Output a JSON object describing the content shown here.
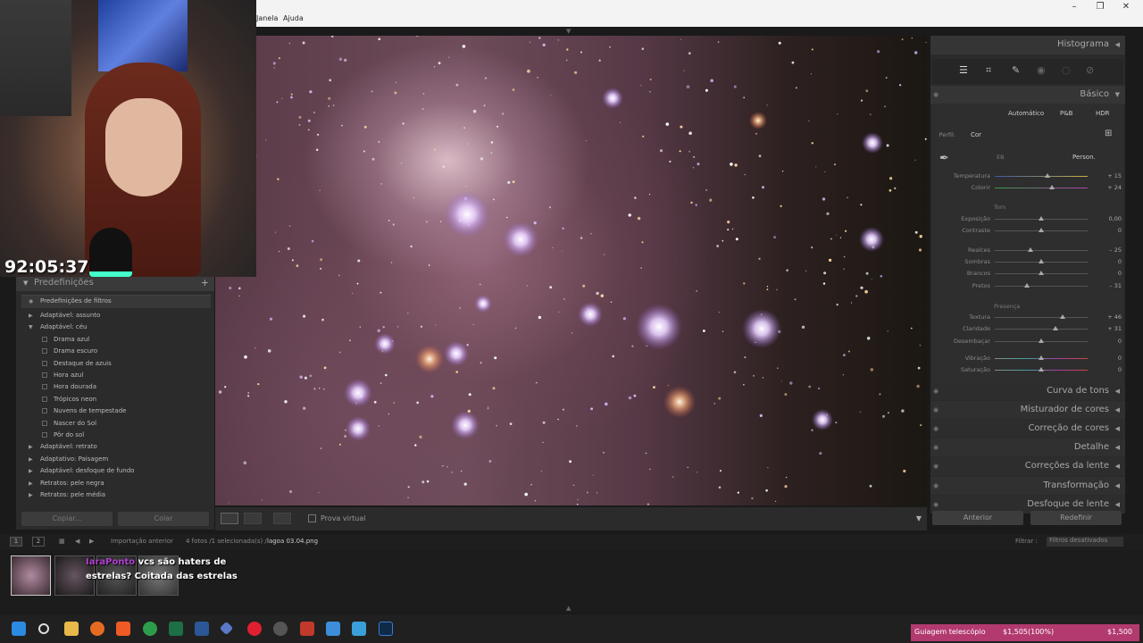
{
  "menu": {
    "items": [
      "Janela",
      "Ajuda"
    ]
  },
  "window": {
    "minimize": "–",
    "restore": "❐",
    "close": "✕"
  },
  "stream": {
    "timer": "92:05:37"
  },
  "presets": {
    "panel_title": "Predefinições",
    "add": "+",
    "items": [
      {
        "label": "Predefinições de filtros",
        "type": "top"
      },
      {
        "label": "Adaptável: assunto",
        "type": "group",
        "expanded": false
      },
      {
        "label": "Adaptável: céu",
        "type": "group",
        "expanded": true
      },
      {
        "label": "Drama azul",
        "type": "preset"
      },
      {
        "label": "Drama escuro",
        "type": "preset"
      },
      {
        "label": "Destaque de azuis",
        "type": "preset"
      },
      {
        "label": "Hora azul",
        "type": "preset"
      },
      {
        "label": "Hora dourada",
        "type": "preset"
      },
      {
        "label": "Trópicos neon",
        "type": "preset"
      },
      {
        "label": "Nuvens de tempestade",
        "type": "preset"
      },
      {
        "label": "Nascer do Sol",
        "type": "preset"
      },
      {
        "label": "Pôr do sol",
        "type": "preset"
      },
      {
        "label": "Adaptável: retrato",
        "type": "group",
        "expanded": false
      },
      {
        "label": "Adaptativo: Paisagem",
        "type": "group",
        "expanded": false
      },
      {
        "label": "Adaptável: desfoque de fundo",
        "type": "group",
        "expanded": false
      },
      {
        "label": "Retratos: pele negra",
        "type": "group",
        "expanded": false
      },
      {
        "label": "Retratos: pele média",
        "type": "group",
        "expanded": false
      }
    ],
    "copy_label": "Copiar...",
    "paste_label": "Colar"
  },
  "toolbar": {
    "soft_proof_label": "Prova virtual"
  },
  "develop": {
    "histogram_label": "Histograma",
    "basic_label": "Básico",
    "treatment": {
      "auto": "Automático",
      "bw": "P&B",
      "hdr": "HDR"
    },
    "profile_label": "Perfil:",
    "profile_value": "Cor",
    "wb_label": "EB",
    "wb_value": "Person.",
    "tone_label": "Tom",
    "presence_label": "Presença",
    "sliders": [
      {
        "label": "Temperatura",
        "value": "+ 15",
        "pos": 0.57,
        "track": "temp"
      },
      {
        "label": "Colorir",
        "value": "+ 24",
        "pos": 0.62,
        "track": "tint"
      },
      {
        "label": "Exposição",
        "value": "0,00",
        "pos": 0.5,
        "track": "plain"
      },
      {
        "label": "Contraste",
        "value": "0",
        "pos": 0.5,
        "track": "plain"
      },
      {
        "label": "Realces",
        "value": "– 25",
        "pos": 0.38,
        "track": "plain"
      },
      {
        "label": "Sombras",
        "value": "0",
        "pos": 0.5,
        "track": "plain"
      },
      {
        "label": "Brancos",
        "value": "0",
        "pos": 0.5,
        "track": "plain"
      },
      {
        "label": "Pretos",
        "value": "– 31",
        "pos": 0.35,
        "track": "plain"
      },
      {
        "label": "Textura",
        "value": "+ 46",
        "pos": 0.73,
        "track": "plain"
      },
      {
        "label": "Claridade",
        "value": "+ 31",
        "pos": 0.65,
        "track": "plain"
      },
      {
        "label": "Desembaçar",
        "value": "0",
        "pos": 0.5,
        "track": "plain"
      },
      {
        "label": "Vibração",
        "value": "0",
        "pos": 0.5,
        "track": "color"
      },
      {
        "label": "Saturação",
        "value": "0",
        "pos": 0.5,
        "track": "color"
      }
    ],
    "panels": [
      "Curva de tons",
      "Misturador de cores",
      "Correção de cores",
      "Detalhe",
      "Correções da lente",
      "Transformação",
      "Desfoque de lente"
    ],
    "previous_label": "Anterior",
    "reset_label": "Redefinir"
  },
  "filmstrip": {
    "page1": "1",
    "page2": "2",
    "source": "Importação anterior",
    "count": "4 fotos /1 selecionada(s) /",
    "filename": "lagoa 03.04.png",
    "filter_label": "Filtrar :",
    "filter_value": "Filtros desativados"
  },
  "chat": {
    "user": "IaraPonto",
    "message": "vcs são haters de estrelas? Coitada das estrelas"
  },
  "ticker": {
    "label": "Guiagem telescópio",
    "progress": "$1,505(100%)",
    "goal": "$1,500"
  },
  "colors": {
    "accent_ticker": "#b23a6e",
    "panel_bg": "#2b2b2b"
  }
}
